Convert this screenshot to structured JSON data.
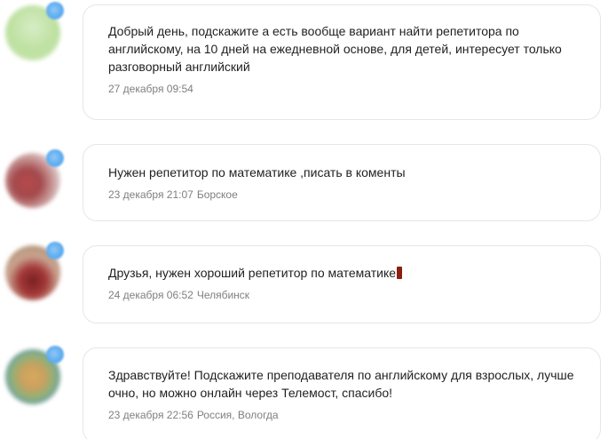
{
  "posts": [
    {
      "text": "Добрый день, подскажите а есть вообще вариант найти репетитора по английскому, на 10 дней на ежедневной основе, для детей, интересует только разговорный английский",
      "date": "27 декабря 09:54",
      "location": ""
    },
    {
      "text": "Нужен репетитор по математике ,писать в коменты",
      "date": "23 декабря 21:07",
      "location": "Борское"
    },
    {
      "text": "Друзья, нужен хороший репетитор по математике",
      "date": "24 декабря 06:52",
      "location": "Челябинск"
    },
    {
      "text": "Здравствуйте! Подскажите преподавателя по английскому для взрослых, лучше очно, но можно онлайн через Телемост, спасибо!",
      "date": "23 декабря 22:56",
      "location": "Россия, Вологда"
    }
  ],
  "colors": {
    "badge": "#5aa9ee",
    "card_border": "#e6e6e6",
    "meta_text": "#7f7f7f",
    "exclamation_emoji": "#8a1f12"
  },
  "icons": {
    "badge": "verified-badge-icon",
    "post3_emoji": "double-exclamation-icon"
  }
}
